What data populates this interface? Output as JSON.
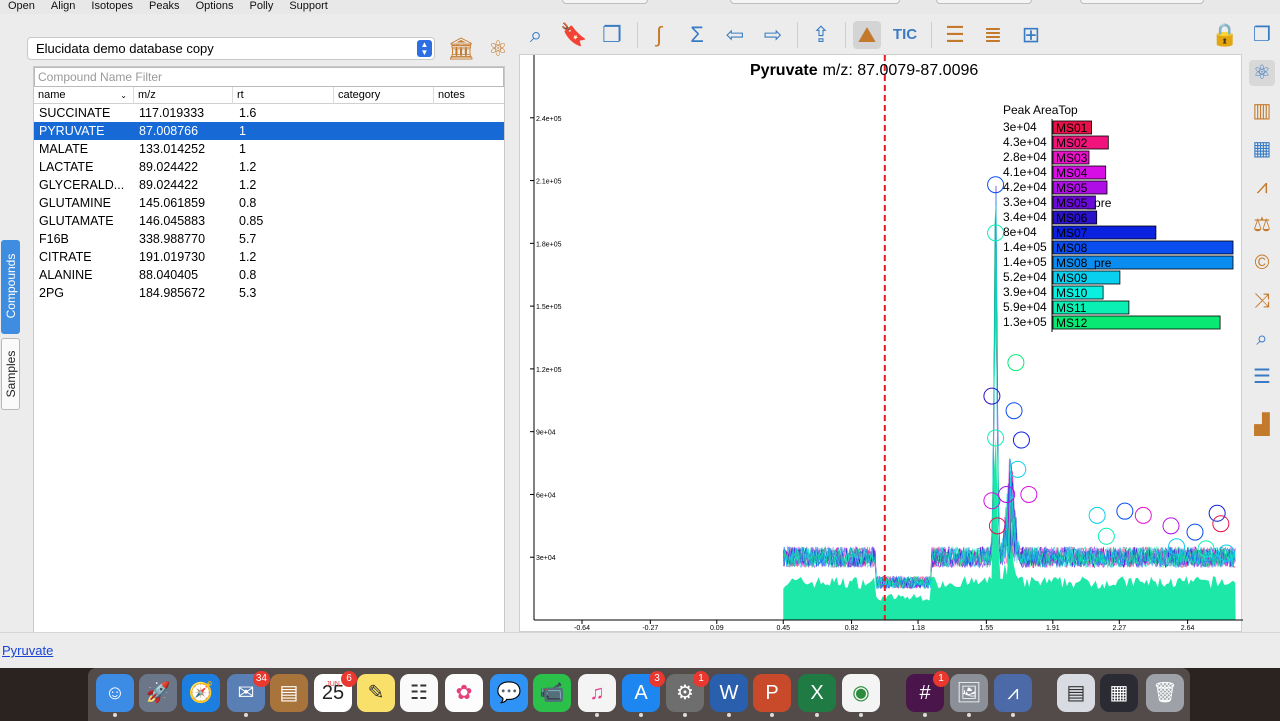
{
  "menu": [
    "Open",
    "Align",
    "Isotopes",
    "Peaks",
    "Options",
    "Polly",
    "Support"
  ],
  "database": {
    "selected": "Elucidata demo database copy"
  },
  "compounds": {
    "filter_placeholder": "Compound Name Filter",
    "columns": [
      "name",
      "m/z",
      "rt",
      "category",
      "notes"
    ],
    "rows": [
      {
        "name": "SUCCINATE",
        "mz": "117.019333",
        "rt": "1.6"
      },
      {
        "name": "PYRUVATE",
        "mz": "87.008766",
        "rt": "1",
        "selected": true
      },
      {
        "name": "MALATE",
        "mz": "133.014252",
        "rt": "1"
      },
      {
        "name": "LACTATE",
        "mz": "89.024422",
        "rt": "1.2"
      },
      {
        "name": "GLYCERALD...",
        "mz": "89.024422",
        "rt": "1.2"
      },
      {
        "name": "GLUTAMINE",
        "mz": "145.061859",
        "rt": "0.8"
      },
      {
        "name": "GLUTAMATE",
        "mz": "146.045883",
        "rt": "0.85"
      },
      {
        "name": "F16B",
        "mz": "338.988770",
        "rt": "5.7"
      },
      {
        "name": "CITRATE",
        "mz": "191.019730",
        "rt": "1.2"
      },
      {
        "name": "ALANINE",
        "mz": "88.040405",
        "rt": "0.8"
      },
      {
        "name": "2PG",
        "mz": "184.985672",
        "rt": "5.3"
      }
    ]
  },
  "side_tabs": {
    "compounds": "Compounds",
    "samples": "Samples"
  },
  "toolbar": {
    "tic_label": "TIC"
  },
  "chart_data": {
    "type": "line",
    "title": "Pyruvate",
    "subtitle": "m/z: 87.0079-87.0096",
    "xlabel": "",
    "ylabel": "",
    "x_ticks": [
      "-0.64",
      "-0.27",
      "0.09",
      "0.45",
      "0.82",
      "1.18",
      "1.55",
      "1.91",
      "2.27",
      "2.64"
    ],
    "y_ticks": [
      "3e+04",
      "6e+04",
      "9e+04",
      "1.2e+05",
      "1.5e+05",
      "1.8e+05",
      "2.1e+05",
      "2.4e+05"
    ],
    "xlim": [
      -0.9,
      2.94
    ],
    "ylim": [
      0,
      270000.0
    ],
    "rt_marker": 1.0,
    "legend_title": "Peak AreaTop",
    "legend_position": "top-right",
    "series": [
      {
        "name": "MS01",
        "value_label": "3e+04",
        "value": 30000,
        "color": "#e8124a"
      },
      {
        "name": "MS02",
        "value_label": "4.3e+04",
        "value": 43000,
        "color": "#f0147c"
      },
      {
        "name": "MS03",
        "value_label": "2.8e+04",
        "value": 28000,
        "color": "#e812c8"
      },
      {
        "name": "MS04",
        "value_label": "4.1e+04",
        "value": 41000,
        "color": "#d80ee6"
      },
      {
        "name": "MS05",
        "value_label": "4.2e+04",
        "value": 42000,
        "color": "#b00ee6"
      },
      {
        "name": "MS05_pre",
        "value_label": "3.3e+04",
        "value": 33000,
        "color": "#6a0ad8"
      },
      {
        "name": "MS06",
        "value_label": "3.4e+04",
        "value": 34000,
        "color": "#2a12c8"
      },
      {
        "name": "MS07",
        "value_label": "8e+04",
        "value": 80000,
        "color": "#0a22e0"
      },
      {
        "name": "MS08",
        "value_label": "1.4e+05",
        "value": 140000,
        "color": "#0a4ef0"
      },
      {
        "name": "MS08_pre",
        "value_label": "1.4e+05",
        "value": 140000,
        "color": "#0a8cf0"
      },
      {
        "name": "MS09",
        "value_label": "5.2e+04",
        "value": 52000,
        "color": "#0ad0f0"
      },
      {
        "name": "MS10",
        "value_label": "3.9e+04",
        "value": 39000,
        "color": "#0af0e0"
      },
      {
        "name": "MS11",
        "value_label": "5.9e+04",
        "value": 59000,
        "color": "#0af0b4"
      },
      {
        "name": "MS12",
        "value_label": "1.3e+05",
        "value": 130000,
        "color": "#0ae874"
      }
    ]
  },
  "status": {
    "link_text": "Pyruvate"
  },
  "dock": {
    "badges": {
      "mail": "34",
      "calendar": "6",
      "appstore": "3",
      "sysprefs": "1",
      "slack": "1"
    },
    "calendar_day": "25",
    "calendar_month": "JUN"
  }
}
